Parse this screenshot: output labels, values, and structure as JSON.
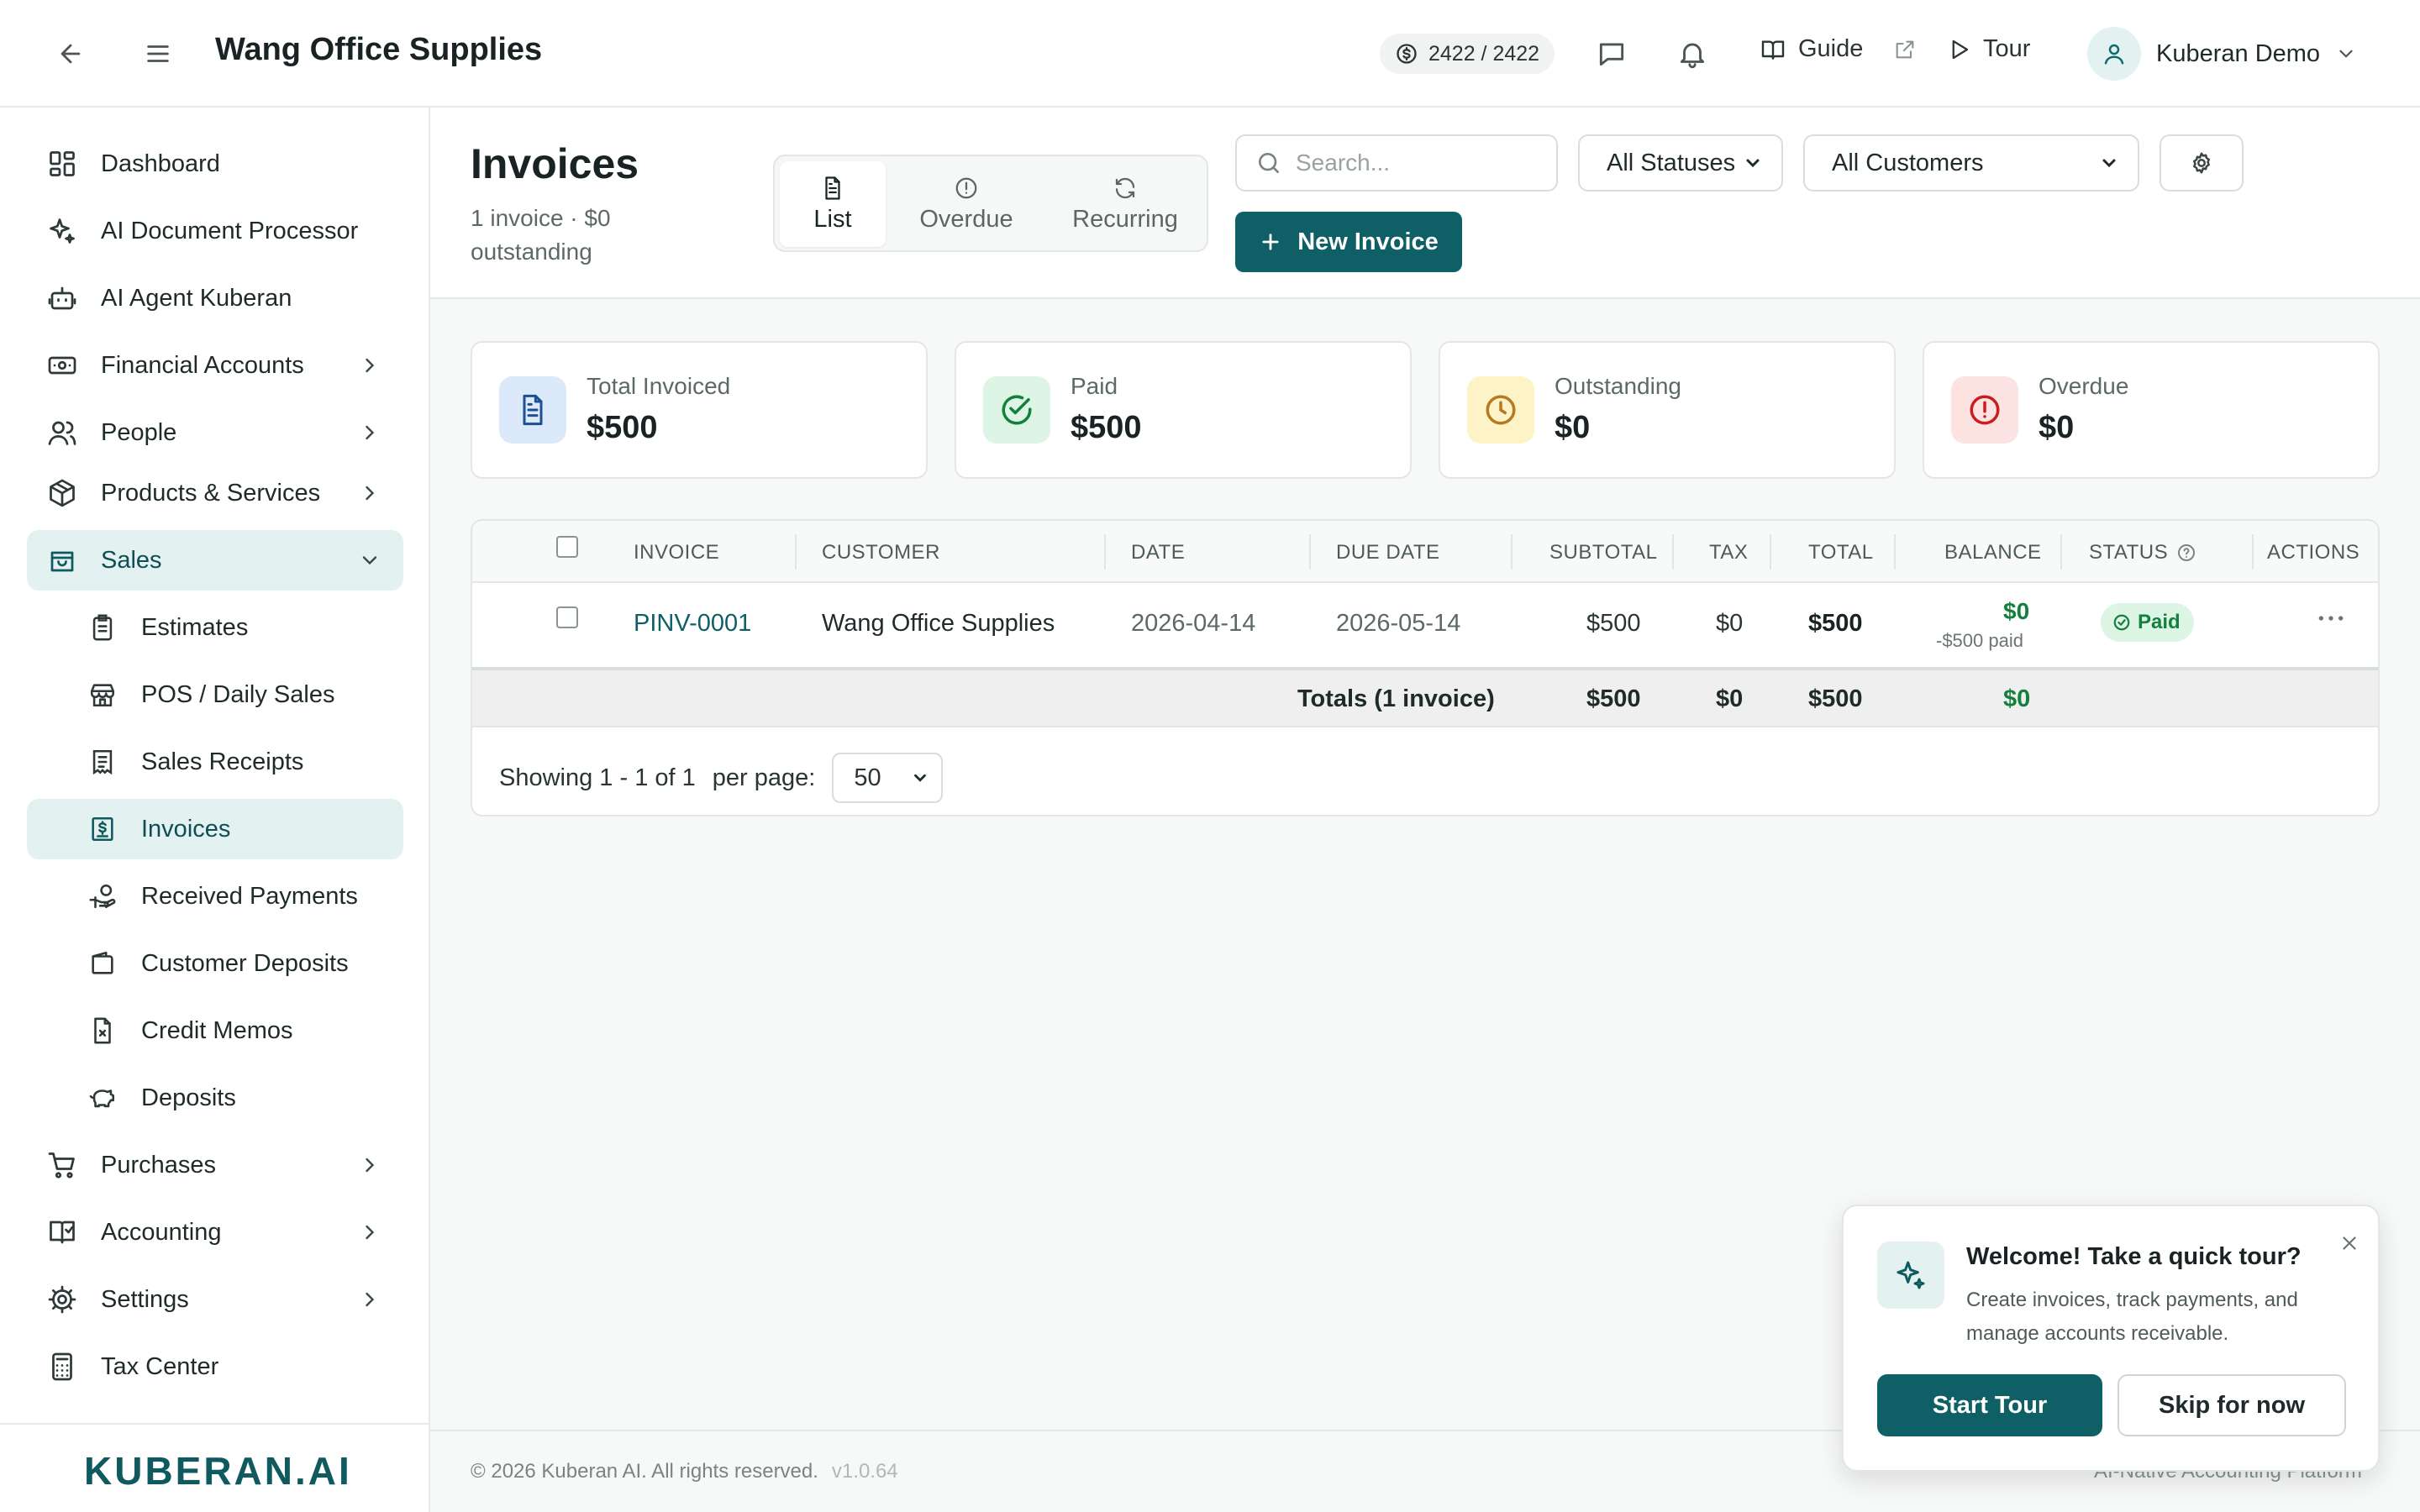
{
  "app": {
    "company": "Wang Office Supplies",
    "credits": "2422 / 2422",
    "guide_label": "Guide",
    "tour_label": "Tour",
    "user_name": "Kuberan Demo",
    "brand": "KUBERAN.AI"
  },
  "sidebar": {
    "items": [
      {
        "label": "Dashboard",
        "icon": "dashboard-icon"
      },
      {
        "label": "AI Document Processor",
        "icon": "sparkle-icon"
      },
      {
        "label": "AI Agent Kuberan",
        "icon": "robot-icon"
      },
      {
        "label": "Financial Accounts",
        "icon": "banknote-icon"
      },
      {
        "label": "People",
        "icon": "people-icon"
      },
      {
        "label": "Products & Services",
        "icon": "box-icon"
      },
      {
        "label": "Sales",
        "icon": "shopping-bag-icon"
      },
      {
        "label": "Estimates",
        "icon": "clipboard-icon"
      },
      {
        "label": "POS / Daily Sales",
        "icon": "store-icon"
      },
      {
        "label": "Sales Receipts",
        "icon": "receipt-icon"
      },
      {
        "label": "Invoices",
        "icon": "invoice-dollar-icon"
      },
      {
        "label": "Received Payments",
        "icon": "hand-coins-icon"
      },
      {
        "label": "Customer Deposits",
        "icon": "wallet-icon"
      },
      {
        "label": "Credit Memos",
        "icon": "file-x-icon"
      },
      {
        "label": "Deposits",
        "icon": "piggy-bank-icon"
      },
      {
        "label": "Purchases",
        "icon": "cart-icon"
      },
      {
        "label": "Accounting",
        "icon": "book-icon"
      },
      {
        "label": "Settings",
        "icon": "gear-icon"
      },
      {
        "label": "Tax Center",
        "icon": "calculator-icon"
      }
    ]
  },
  "page": {
    "title": "Invoices",
    "subtitle": "1 invoice · $0 outstanding",
    "tabs": [
      {
        "label": "List",
        "icon": "document-icon"
      },
      {
        "label": "Overdue",
        "icon": "alert-circle-icon"
      },
      {
        "label": "Recurring",
        "icon": "refresh-icon"
      }
    ],
    "search_placeholder": "Search...",
    "status_filter": "All Statuses",
    "customer_filter": "All Customers",
    "new_button": "New Invoice"
  },
  "stats": [
    {
      "label": "Total Invoiced",
      "value": "$500",
      "color": "#dbe9fb"
    },
    {
      "label": "Paid",
      "value": "$500",
      "color": "#dcf5e4"
    },
    {
      "label": "Outstanding",
      "value": "$0",
      "color": "#fdf3c7"
    },
    {
      "label": "Overdue",
      "value": "$0",
      "color": "#fde2e2"
    }
  ],
  "table": {
    "headers": {
      "invoice": "INVOICE",
      "customer": "CUSTOMER",
      "date": "DATE",
      "due_date": "DUE DATE",
      "subtotal": "SUBTOTAL",
      "tax": "TAX",
      "total": "TOTAL",
      "balance": "BALANCE",
      "status": "STATUS",
      "actions": "ACTIONS"
    },
    "rows": [
      {
        "invoice": "PINV-0001",
        "customer": "Wang Office Supplies",
        "date": "2026-04-14",
        "due_date": "2026-05-14",
        "subtotal": "$500",
        "tax": "$0",
        "total": "$500",
        "balance": "$0",
        "balance_note": "-$500 paid",
        "status": "Paid"
      }
    ],
    "totals": {
      "label": "Totals (1 invoice)",
      "subtotal": "$500",
      "tax": "$0",
      "total": "$500",
      "balance": "$0"
    },
    "pagination": {
      "showing": "Showing 1 - 1 of 1",
      "per_page_label": "per page:",
      "per_page": "50"
    }
  },
  "footer": {
    "copyright": "© 2026 Kuberan AI. All rights reserved.",
    "version": "v1.0.64",
    "tagline": "AI-Native Accounting Platform"
  },
  "tour_popup": {
    "title": "Welcome! Take a quick tour?",
    "text": "Create invoices, track payments, and manage accounts receivable.",
    "start": "Start Tour",
    "skip": "Skip for now"
  },
  "colors": {
    "accent": "#0f5f66",
    "paid_green": "#15803d",
    "invoice_link": "#0f5f66"
  }
}
